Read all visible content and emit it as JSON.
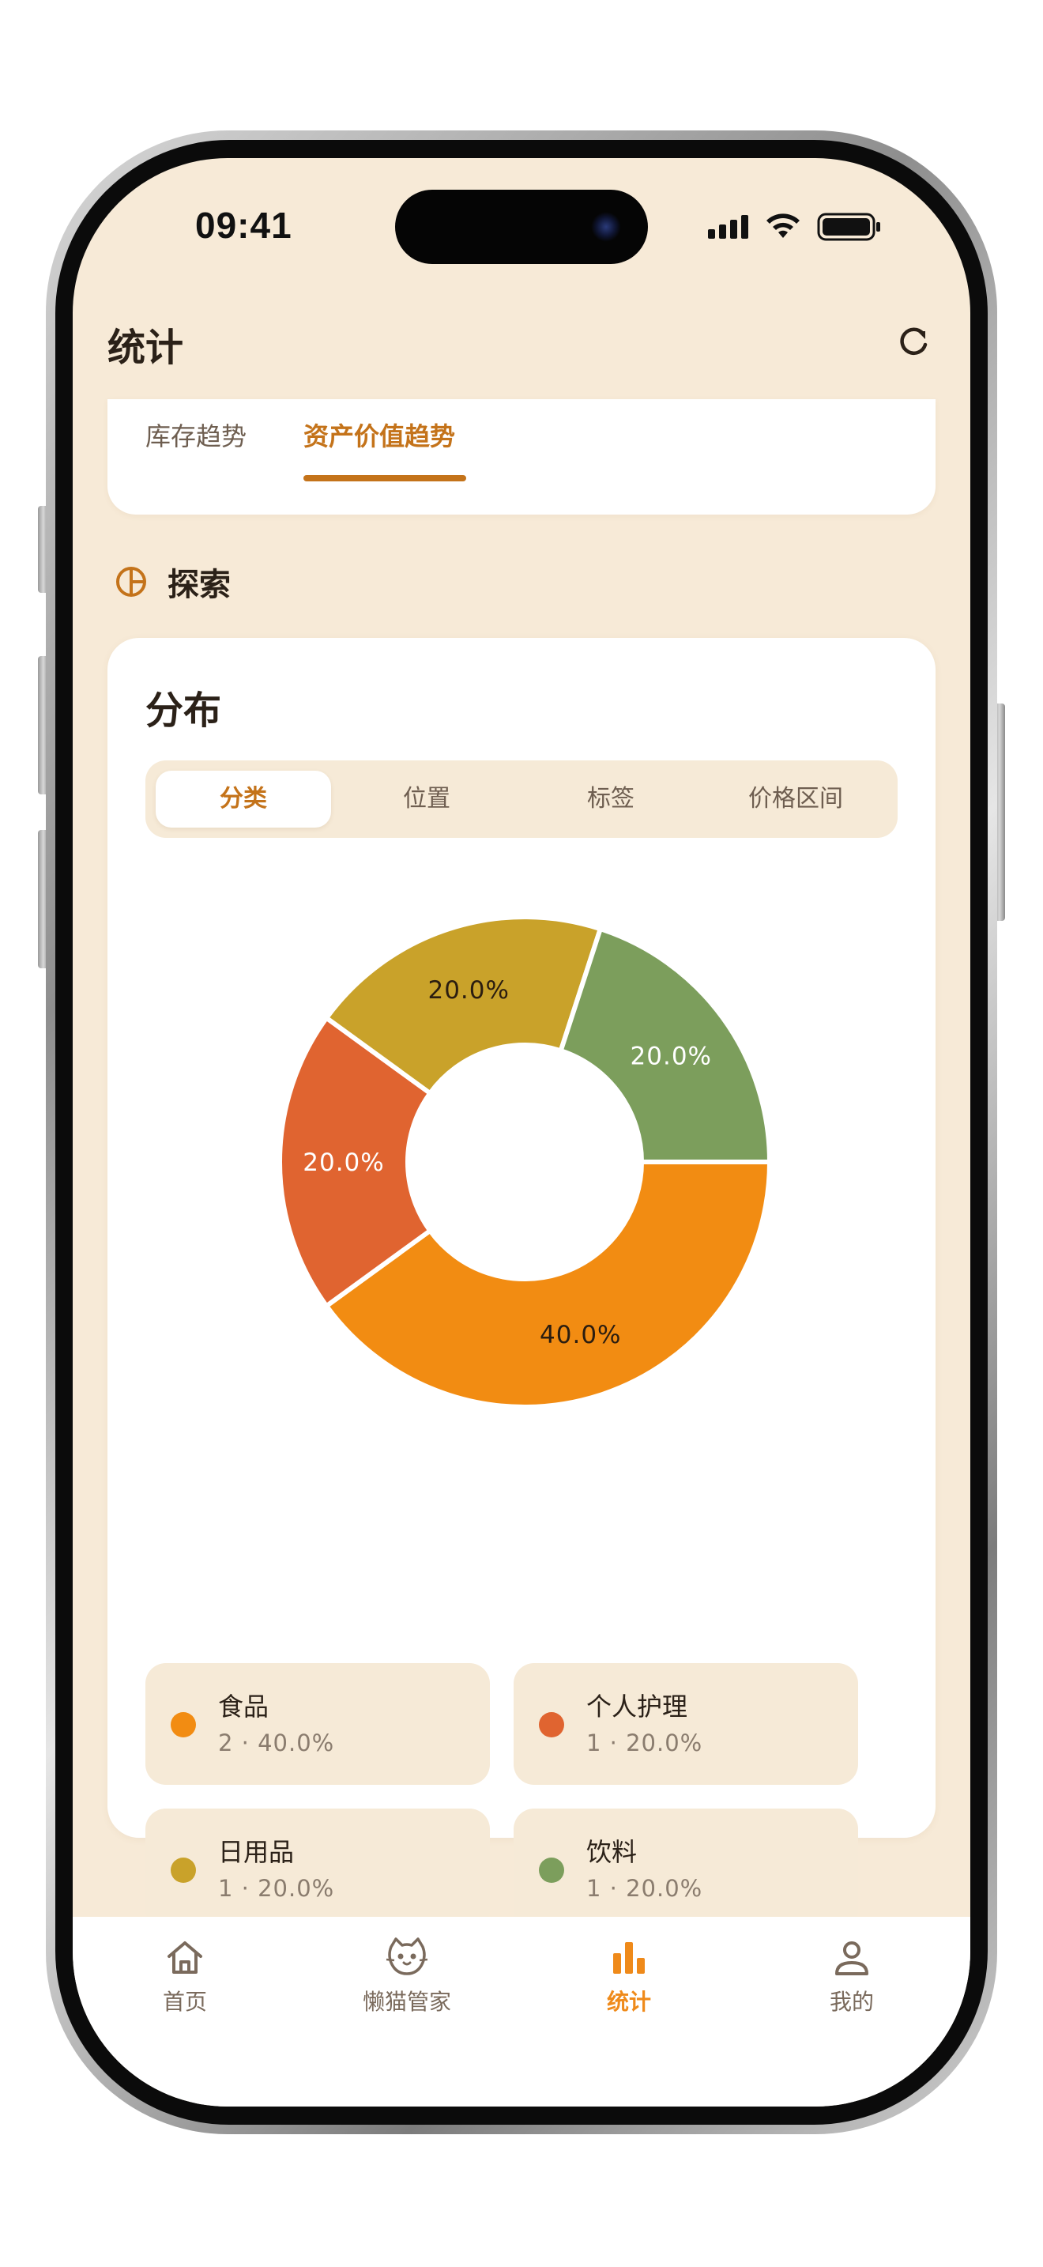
{
  "status_bar": {
    "time": "09:41"
  },
  "header": {
    "title": "统计",
    "refresh_icon": "refresh-icon"
  },
  "trend": {
    "tabs": [
      {
        "label": "库存趋势",
        "active": false
      },
      {
        "label": "资产价值趋势",
        "active": true
      }
    ]
  },
  "explore": {
    "label": "探索",
    "icon": "pie-chart-icon"
  },
  "distribution": {
    "title": "分布",
    "segments": [
      {
        "label": "分类",
        "active": true
      },
      {
        "label": "位置",
        "active": false
      },
      {
        "label": "标签",
        "active": false
      },
      {
        "label": "价格区间",
        "active": false
      }
    ],
    "legend": [
      {
        "name": "食品",
        "stat": "2 · 40.0%",
        "color": "#f28c12"
      },
      {
        "name": "个人护理",
        "stat": "1 · 20.0%",
        "color": "#e06430"
      },
      {
        "name": "日用品",
        "stat": "1 · 20.0%",
        "color": "#c9a22a"
      },
      {
        "name": "饮料",
        "stat": "1 · 20.0%",
        "color": "#7c9e5c"
      }
    ]
  },
  "chart_data": {
    "type": "pie",
    "style": "donut",
    "categories": [
      "食品",
      "个人护理",
      "日用品",
      "饮料"
    ],
    "values": [
      40.0,
      20.0,
      20.0,
      20.0
    ],
    "counts": [
      2,
      1,
      1,
      1
    ],
    "labels": [
      "40.0%",
      "20.0%",
      "20.0%",
      "20.0%"
    ],
    "colors": [
      "#f28c12",
      "#e06430",
      "#c9a22a",
      "#7c9e5c"
    ]
  },
  "tabbar": {
    "items": [
      {
        "label": "首页",
        "icon": "home-icon",
        "active": false
      },
      {
        "label": "懒猫管家",
        "icon": "cat-icon",
        "active": false
      },
      {
        "label": "统计",
        "icon": "bar-chart-icon",
        "active": true
      },
      {
        "label": "我的",
        "icon": "user-icon",
        "active": false
      }
    ]
  },
  "colors": {
    "accent": "#c4731a",
    "tab_active": "#ef8a1a",
    "background": "#f7ead7"
  }
}
